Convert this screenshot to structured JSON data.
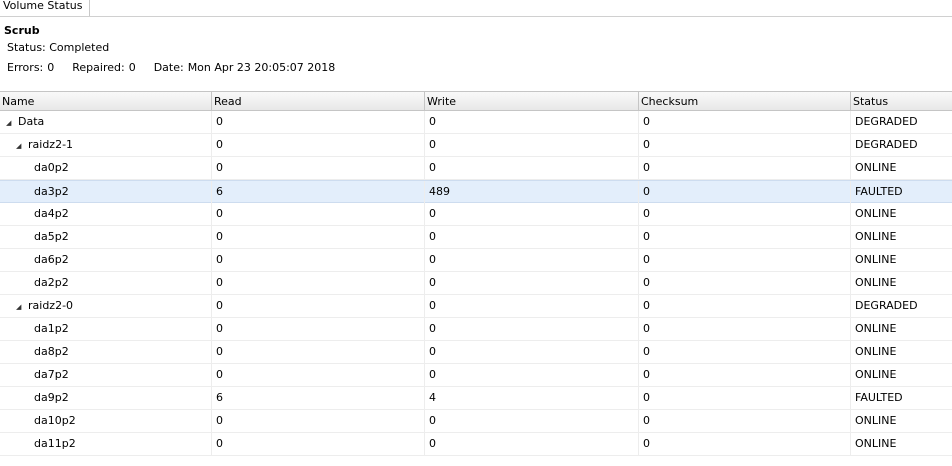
{
  "tab": {
    "label": "Volume Status"
  },
  "scrub": {
    "title": "Scrub",
    "status": "Status: Completed",
    "errors_label": "Errors:",
    "errors_value": "0",
    "repaired_label": "Repaired:",
    "repaired_value": "0",
    "date_label": "Date:",
    "date_value": "Mon Apr 23 20:05:07 2018"
  },
  "table": {
    "columns": [
      "Name",
      "Read",
      "Write",
      "Checksum",
      "Status"
    ],
    "rows": [
      {
        "name": "Data",
        "level": 0,
        "expandable": true,
        "read": "0",
        "write": "0",
        "checksum": "0",
        "status": "DEGRADED"
      },
      {
        "name": "raidz2-1",
        "level": 1,
        "expandable": true,
        "read": "0",
        "write": "0",
        "checksum": "0",
        "status": "DEGRADED"
      },
      {
        "name": "da0p2",
        "level": 2,
        "expandable": false,
        "read": "0",
        "write": "0",
        "checksum": "0",
        "status": "ONLINE"
      },
      {
        "name": "da3p2",
        "level": 2,
        "expandable": false,
        "read": "6",
        "write": "489",
        "checksum": "0",
        "status": "FAULTED",
        "selected": true
      },
      {
        "name": "da4p2",
        "level": 2,
        "expandable": false,
        "read": "0",
        "write": "0",
        "checksum": "0",
        "status": "ONLINE"
      },
      {
        "name": "da5p2",
        "level": 2,
        "expandable": false,
        "read": "0",
        "write": "0",
        "checksum": "0",
        "status": "ONLINE"
      },
      {
        "name": "da6p2",
        "level": 2,
        "expandable": false,
        "read": "0",
        "write": "0",
        "checksum": "0",
        "status": "ONLINE"
      },
      {
        "name": "da2p2",
        "level": 2,
        "expandable": false,
        "read": "0",
        "write": "0",
        "checksum": "0",
        "status": "ONLINE"
      },
      {
        "name": "raidz2-0",
        "level": 1,
        "expandable": true,
        "read": "0",
        "write": "0",
        "checksum": "0",
        "status": "DEGRADED"
      },
      {
        "name": "da1p2",
        "level": 2,
        "expandable": false,
        "read": "0",
        "write": "0",
        "checksum": "0",
        "status": "ONLINE"
      },
      {
        "name": "da8p2",
        "level": 2,
        "expandable": false,
        "read": "0",
        "write": "0",
        "checksum": "0",
        "status": "ONLINE"
      },
      {
        "name": "da7p2",
        "level": 2,
        "expandable": false,
        "read": "0",
        "write": "0",
        "checksum": "0",
        "status": "ONLINE"
      },
      {
        "name": "da9p2",
        "level": 2,
        "expandable": false,
        "read": "6",
        "write": "4",
        "checksum": "0",
        "status": "FAULTED"
      },
      {
        "name": "da10p2",
        "level": 2,
        "expandable": false,
        "read": "0",
        "write": "0",
        "checksum": "0",
        "status": "ONLINE"
      },
      {
        "name": "da11p2",
        "level": 2,
        "expandable": false,
        "read": "0",
        "write": "0",
        "checksum": "0",
        "status": "ONLINE"
      }
    ]
  },
  "icons": {
    "expander": "expanded-triangle-icon"
  }
}
